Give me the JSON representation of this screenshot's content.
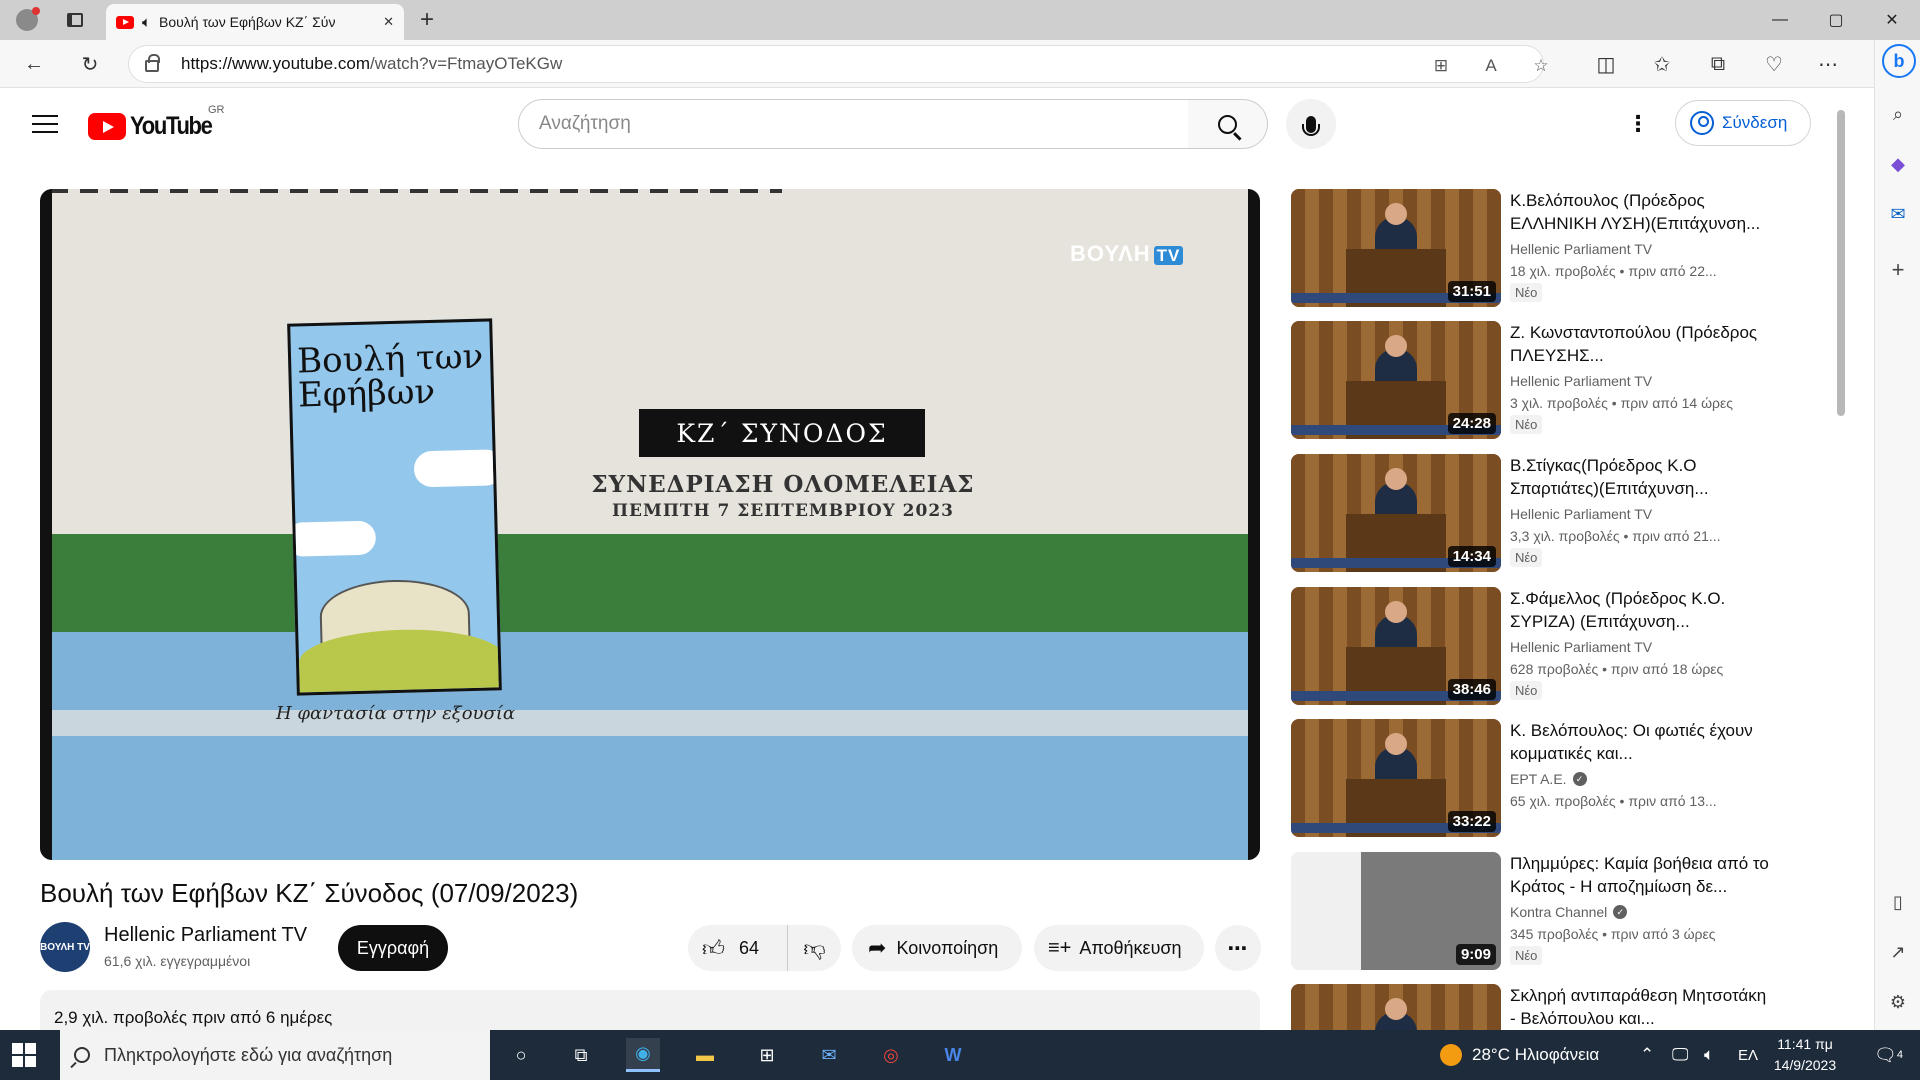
{
  "browser": {
    "tab_title": "Βουλή των Εφήβων ΚΖ΄ Σύν",
    "new_tab_glyph": "+",
    "window_controls": {
      "minimize": "—",
      "maximize": "▢",
      "close": "✕"
    },
    "url_host": "https://www.youtube.com",
    "url_path": "/watch?v=FtmayOTeKGw"
  },
  "youtube": {
    "logo_text": "YouTube",
    "country_code": "GR",
    "search_placeholder": "Αναζήτηση",
    "sign_in_label": "Σύνδεση"
  },
  "player": {
    "channel_logo_text": "ΒΟΥΛΗ",
    "channel_logo_badge": "TV",
    "poster_title": "Βουλή των Εφήβων",
    "slogan": "Η φαντασία στην εξουσία",
    "session_box": "ΚΖ΄ ΣΥΝΟΔΟΣ",
    "session_line": "ΣΥΝΕΔΡΙΑΣΗ ΟΛΟΜΕΛΕΙΑΣ",
    "session_date": "ΠΕΜΠΤΗ 7 ΣΕΠΤΕΜΒΡΙΟΥ 2023"
  },
  "video": {
    "title": "Βουλή των Εφήβων ΚΖ΄ Σύνοδος (07/09/2023)",
    "channel_name": "Hellenic Parliament TV",
    "channel_avatar_text": "ΒΟΥΛΗ TV",
    "subscribers": "61,6 χιλ. εγγεγραμμένοι",
    "subscribe_label": "Εγγραφή",
    "likes": "64",
    "share_label": "Κοινοποίηση",
    "save_label": "Αποθήκευση",
    "description_meta": "2,9 χιλ. προβολές  πριν από 6 ημέρες"
  },
  "recommendations": [
    {
      "title": "Κ.Βελόπουλος (Πρόεδρος ΕΛΛΗΝΙΚΗ ΛΥΣΗ)(Επιτάχυνση...",
      "channel": "Hellenic Parliament TV",
      "verified": false,
      "meta": "18 χιλ. προβολές  • πριν από 22...",
      "badge": "Νέο",
      "duration": "31:51",
      "kind": "parliament"
    },
    {
      "title": "Ζ. Κωνσταντοπούλου (Πρόεδρος ΠΛΕΥΣΗΣ...",
      "channel": "Hellenic Parliament TV",
      "verified": false,
      "meta": "3 χιλ. προβολές  • πριν από 14 ώρες",
      "badge": "Νέο",
      "duration": "24:28",
      "kind": "parliament"
    },
    {
      "title": "Β.Στίγκας(Πρόεδρος Κ.Ο Σπαρτιάτες)(Επιτάχυνση...",
      "channel": "Hellenic Parliament TV",
      "verified": false,
      "meta": "3,3 χιλ. προβολές  • πριν από 21...",
      "badge": "Νέο",
      "duration": "14:34",
      "kind": "parliament"
    },
    {
      "title": "Σ.Φάμελλος (Πρόεδρος Κ.Ο. ΣΥΡΙΖΑ) (Επιτάχυνση...",
      "channel": "Hellenic Parliament TV",
      "verified": false,
      "meta": "628 προβολές  • πριν από 18 ώρες",
      "badge": "Νέο",
      "duration": "38:46",
      "kind": "parliament"
    },
    {
      "title": "Κ. Βελόπουλος: Οι φωτιές έχουν κομματικές και...",
      "channel": "ΕΡΤ Α.Ε.",
      "verified": true,
      "meta": "65 χιλ. προβολές  • πριν από 13...",
      "badge": "",
      "duration": "33:22",
      "kind": "parliament"
    },
    {
      "title": "Πλημμύρες: Καμία βοήθεια από το Κράτος - Η αποζημίωση δε...",
      "channel": "Kontra Channel",
      "verified": true,
      "meta": "345 προβολές  • πριν από 3 ώρες",
      "badge": "Νέο",
      "duration": "9:09",
      "kind": "news"
    },
    {
      "title": "Σκληρή αντιπαράθεση Μητσοτάκη - Βελόπουλου και...",
      "channel": "",
      "verified": false,
      "meta": "",
      "badge": "",
      "duration": "",
      "kind": "parliament"
    }
  ],
  "taskbar": {
    "search_placeholder": "Πληκτρολογήστε εδώ για αναζήτηση",
    "weather": "28°C  Ηλιοφάνεια",
    "language": "ΕΛ",
    "time": "11:41 πμ",
    "date": "14/9/2023",
    "notifications": "4"
  }
}
